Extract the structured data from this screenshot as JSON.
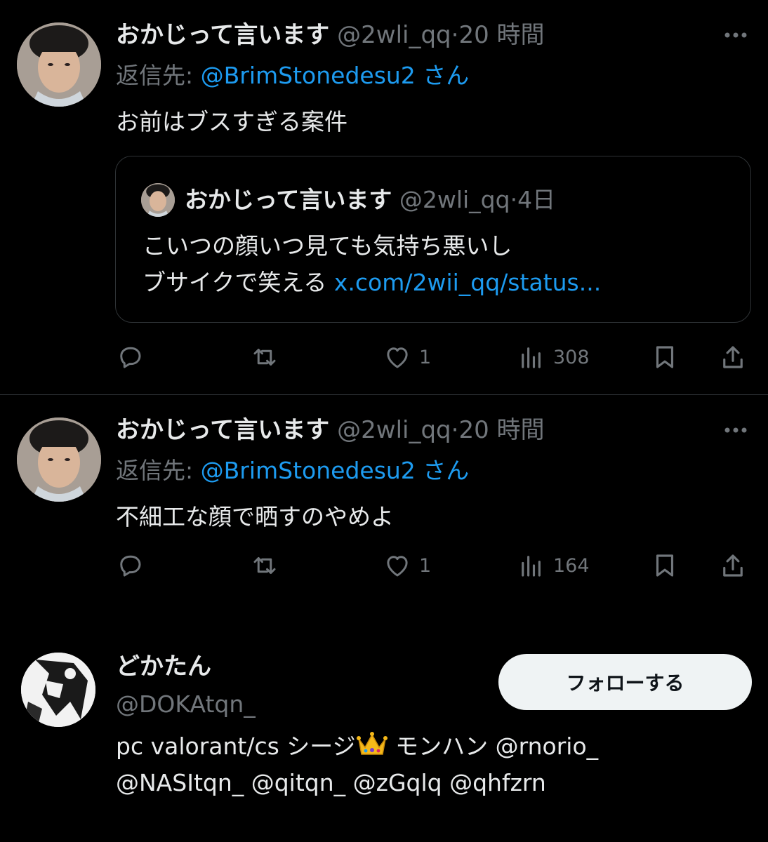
{
  "tweets": [
    {
      "author_name": "おかじって言います",
      "author_handle": "@2wli_qq",
      "separator": "·",
      "time": "20 時間",
      "reply_prefix": "返信先:",
      "reply_to": "@BrimStonedesu2",
      "reply_suffix": "さん",
      "text": "お前はブスすぎる案件",
      "quote": {
        "author_name": "おかじって言います",
        "author_handle": "@2wli_qq",
        "separator": "·",
        "time": "4日",
        "line1": "こいつの顔いつ見ても気持ち悪いし",
        "line2_text": "ブサイクで笑える",
        "line2_link": "x.com/2wii_qq/status..."
      },
      "likes": "1",
      "views": "308"
    },
    {
      "author_name": "おかじって言います",
      "author_handle": "@2wli_qq",
      "separator": "·",
      "time": "20 時間",
      "reply_prefix": "返信先:",
      "reply_to": "@BrimStonedesu2",
      "reply_suffix": "さん",
      "text": "不細工な顔で晒すのやめよ",
      "likes": "1",
      "views": "164"
    }
  ],
  "user_card": {
    "name": "どかたん",
    "handle": "@DOKAtqn_",
    "follow_label": "フォローする",
    "bio_line1_a": "pc valorant/cs シージ",
    "bio_emoji": "crown-emoji",
    "bio_line1_b": "モンハン",
    "bio_line1_mention": "@rnorio_",
    "bio_line2": "@NASItqn_ @qitqn_ @zGqlq @qhfzrn"
  },
  "colors": {
    "background": "#000000",
    "text": "#e7e9ea",
    "secondary": "#71767b",
    "link": "#1d9bf0",
    "border": "#2f3336",
    "button_bg": "#eff3f4"
  }
}
